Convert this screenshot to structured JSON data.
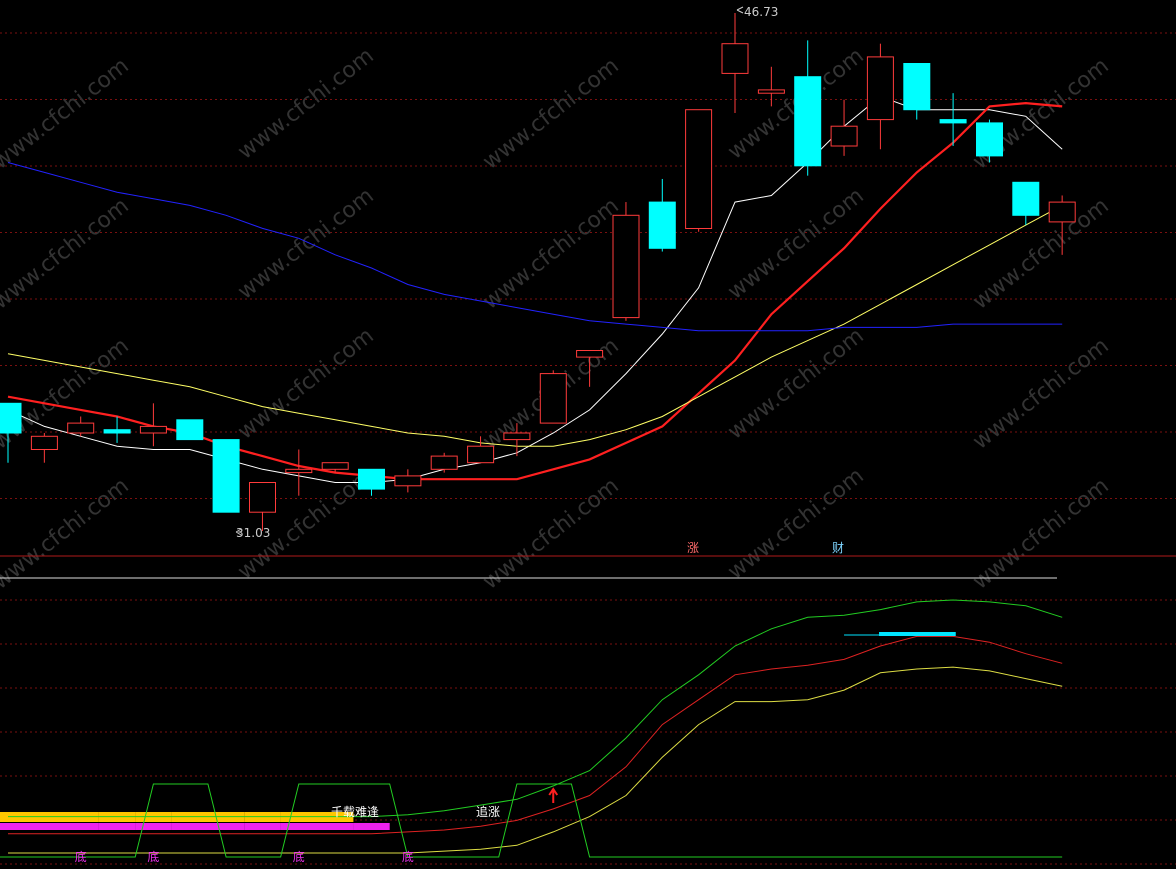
{
  "chart_data": [
    {
      "type": "candlestick",
      "title": "",
      "labels": {
        "high": "46.73",
        "low": "31.03"
      },
      "markers": [
        {
          "text": "涨",
          "color": "#ff6a6a"
        },
        {
          "text": "财",
          "color": "#7ed4ff"
        }
      ],
      "candles": [
        {
          "o": 34.0,
          "h": 34.8,
          "l": 33.1,
          "c": 34.9,
          "dir": "down"
        },
        {
          "o": 33.5,
          "h": 34.0,
          "l": 33.1,
          "c": 33.9,
          "dir": "up"
        },
        {
          "o": 34.0,
          "h": 34.5,
          "l": 33.9,
          "c": 34.3,
          "dir": "up"
        },
        {
          "o": 34.1,
          "h": 34.5,
          "l": 33.7,
          "c": 34.0,
          "dir": "down"
        },
        {
          "o": 34.0,
          "h": 34.9,
          "l": 33.6,
          "c": 34.2,
          "dir": "up"
        },
        {
          "o": 34.4,
          "h": 34.4,
          "l": 33.8,
          "c": 33.8,
          "dir": "down"
        },
        {
          "o": 33.8,
          "h": 33.8,
          "l": 31.6,
          "c": 31.6,
          "dir": "down"
        },
        {
          "o": 31.6,
          "h": 31.6,
          "l": 31.03,
          "c": 32.5,
          "dir": "up"
        },
        {
          "o": 32.8,
          "h": 33.5,
          "l": 32.1,
          "c": 32.9,
          "dir": "up"
        },
        {
          "o": 32.9,
          "h": 33.0,
          "l": 32.8,
          "c": 33.1,
          "dir": "up"
        },
        {
          "o": 32.9,
          "h": 32.9,
          "l": 32.1,
          "c": 32.3,
          "dir": "down"
        },
        {
          "o": 32.4,
          "h": 32.9,
          "l": 32.2,
          "c": 32.7,
          "dir": "up"
        },
        {
          "o": 32.9,
          "h": 33.4,
          "l": 32.8,
          "c": 33.3,
          "dir": "up"
        },
        {
          "o": 33.1,
          "h": 33.9,
          "l": 33.1,
          "c": 33.6,
          "dir": "up"
        },
        {
          "o": 33.8,
          "h": 34.3,
          "l": 33.3,
          "c": 34.0,
          "dir": "up"
        },
        {
          "o": 34.3,
          "h": 35.9,
          "l": 34.3,
          "c": 35.8,
          "dir": "up"
        },
        {
          "o": 36.3,
          "h": 36.5,
          "l": 35.4,
          "c": 36.5,
          "dir": "up"
        },
        {
          "o": 37.5,
          "h": 41.0,
          "l": 37.4,
          "c": 40.6,
          "dir": "up"
        },
        {
          "o": 41.0,
          "h": 41.7,
          "l": 39.5,
          "c": 39.6,
          "dir": "down"
        },
        {
          "o": 40.2,
          "h": 43.8,
          "l": 40.1,
          "c": 43.8,
          "dir": "up"
        },
        {
          "o": 44.9,
          "h": 46.73,
          "l": 43.7,
          "c": 45.8,
          "dir": "up"
        },
        {
          "o": 44.3,
          "h": 45.1,
          "l": 43.9,
          "c": 44.4,
          "dir": "up"
        },
        {
          "o": 44.8,
          "h": 45.9,
          "l": 41.8,
          "c": 42.1,
          "dir": "down"
        },
        {
          "o": 42.7,
          "h": 44.1,
          "l": 42.4,
          "c": 43.3,
          "dir": "up"
        },
        {
          "o": 43.5,
          "h": 45.8,
          "l": 42.6,
          "c": 45.4,
          "dir": "up"
        },
        {
          "o": 45.2,
          "h": 45.2,
          "l": 43.5,
          "c": 43.8,
          "dir": "down"
        },
        {
          "o": 43.5,
          "h": 44.3,
          "l": 42.7,
          "c": 43.4,
          "dir": "down"
        },
        {
          "o": 43.4,
          "h": 43.5,
          "l": 42.2,
          "c": 42.4,
          "dir": "down"
        },
        {
          "o": 41.6,
          "h": 41.6,
          "l": 40.3,
          "c": 40.6,
          "dir": "down"
        },
        {
          "o": 40.4,
          "h": 41.2,
          "l": 39.4,
          "c": 41.0,
          "dir": "up"
        }
      ],
      "moving_averages": [
        {
          "color": "#ffffff",
          "values": [
            34.7,
            34.2,
            33.9,
            33.6,
            33.5,
            33.5,
            33.2,
            32.9,
            32.7,
            32.5,
            32.5,
            32.6,
            32.9,
            33.1,
            33.4,
            34.0,
            34.7,
            35.8,
            37.0,
            38.4,
            41.0,
            41.2,
            42.2,
            43.3,
            44.2,
            43.8,
            43.8,
            43.8,
            43.6,
            42.6
          ]
        },
        {
          "color": "#ff2020",
          "values": [
            35.1,
            34.9,
            34.7,
            34.5,
            34.2,
            34.0,
            33.6,
            33.3,
            33.0,
            32.8,
            32.7,
            32.6,
            32.6,
            32.6,
            32.6,
            32.9,
            33.2,
            33.7,
            34.2,
            35.2,
            36.2,
            37.6,
            38.6,
            39.6,
            40.8,
            41.9,
            42.8,
            43.9,
            44.0,
            43.9
          ]
        },
        {
          "color": "#ffff66",
          "values": [
            36.4,
            36.2,
            36.0,
            35.8,
            35.6,
            35.4,
            35.1,
            34.8,
            34.6,
            34.4,
            34.2,
            34.0,
            33.9,
            33.7,
            33.6,
            33.6,
            33.8,
            34.1,
            34.5,
            35.1,
            35.7,
            36.3,
            36.8,
            37.3,
            37.9,
            38.5,
            39.1,
            39.7,
            40.3,
            40.9
          ]
        },
        {
          "color": "#2222ff",
          "values": [
            42.2,
            41.9,
            41.6,
            41.3,
            41.1,
            40.9,
            40.6,
            40.2,
            39.9,
            39.4,
            39.0,
            38.5,
            38.2,
            38.0,
            37.8,
            37.6,
            37.4,
            37.3,
            37.2,
            37.1,
            37.1,
            37.1,
            37.1,
            37.2,
            37.2,
            37.2,
            37.3,
            37.3,
            37.3,
            37.3
          ]
        }
      ]
    },
    {
      "type": "line",
      "title": "",
      "texts": {
        "top_band": "千载难逢",
        "chase": "追涨",
        "bottom_label": "底"
      },
      "band_lines": [
        {
          "color": "#22cc22",
          "values": [
            14,
            14,
            14,
            14,
            14,
            14,
            14,
            14,
            14,
            14,
            14,
            15,
            17,
            20,
            23,
            30,
            38,
            55,
            75,
            88,
            103,
            112,
            118,
            119,
            122,
            126,
            127,
            126,
            124,
            118
          ]
        },
        {
          "color": "#dd2222",
          "values": [
            5,
            5,
            5,
            5,
            5,
            5,
            5,
            5,
            5,
            5,
            5,
            6,
            7,
            9,
            12,
            18,
            25,
            40,
            62,
            75,
            88,
            91,
            93,
            96,
            103,
            108,
            108,
            105,
            99,
            94
          ]
        },
        {
          "color": "#dddd44",
          "values": [
            -5,
            -5,
            -5,
            -5,
            -5,
            -5,
            -5,
            -5,
            -5,
            -5,
            -5,
            -5,
            -4,
            -3,
            -1,
            6,
            14,
            25,
            45,
            62,
            74,
            74,
            75,
            80,
            89,
            91,
            92,
            90,
            86,
            82
          ]
        }
      ],
      "spike_line": {
        "color": "#22cc22",
        "values": [
          0,
          0,
          0,
          0,
          1,
          1,
          0,
          0,
          1,
          1,
          1,
          0,
          0,
          0,
          1,
          1,
          0,
          0,
          0,
          0,
          0,
          0,
          0,
          0,
          0,
          0,
          0,
          0,
          0,
          0
        ]
      },
      "bars_gold": [
        1,
        1,
        1,
        1,
        1,
        1,
        1,
        1,
        1,
        1,
        0,
        0,
        0,
        0,
        0,
        0,
        0,
        0,
        0,
        0,
        0,
        0,
        0,
        0,
        0,
        0,
        0,
        0,
        0,
        0
      ],
      "bars_magenta": [
        1,
        1,
        1,
        1,
        1,
        1,
        1,
        1,
        1,
        1,
        1,
        0,
        0,
        0,
        0,
        0,
        0,
        0,
        0,
        0,
        0,
        0,
        0,
        0,
        0,
        0,
        0,
        0,
        0,
        0
      ],
      "cyan_bar": {
        "from_index": 23,
        "to_index": 26
      }
    }
  ],
  "watermark": "www.cfchi.com",
  "colors": {
    "up": "#ff3b3b",
    "down": "#00ffff",
    "grid": "#7a1010",
    "panel_sep": "#b01a1a"
  }
}
